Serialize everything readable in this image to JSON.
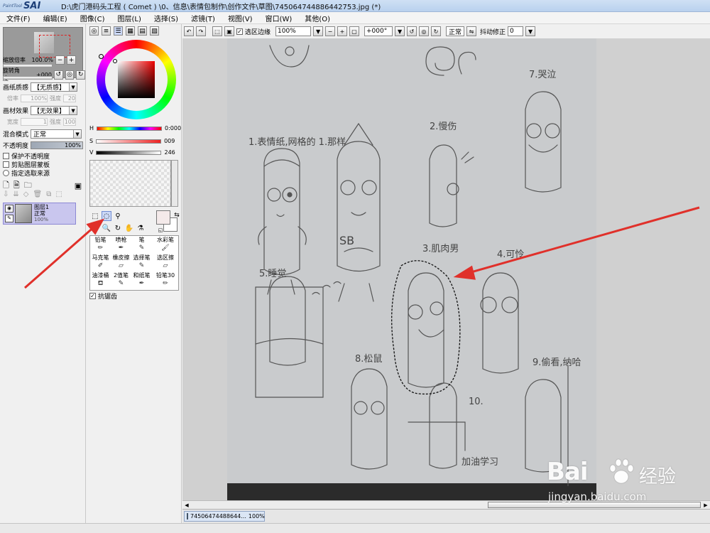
{
  "app": {
    "logo_small": "PaintTool",
    "logo_big": "SAI",
    "window_title": "D:\\虎门港码头工程 ( Comet ) \\0、信息\\表情包制作\\创作文件\\草图\\745064744886442753.jpg (*)"
  },
  "menu": [
    "文件(F)",
    "编辑(E)",
    "图像(C)",
    "图层(L)",
    "选择(S)",
    "滤镜(T)",
    "视图(V)",
    "窗口(W)",
    "其他(O)"
  ],
  "navigator": {
    "zoom_label": "缩放倍率",
    "zoom_value": "100.0%",
    "rotate_label": "旋转角度",
    "rotate_value": "+000"
  },
  "paper_texture": {
    "label": "画纸质感",
    "value": "【无质感】",
    "scale_label": "倍率",
    "scale_value": "100%",
    "strength_label": "强度",
    "strength_value": "20"
  },
  "paper_effect": {
    "label": "画材效果",
    "value": "【无效果】",
    "width_label": "宽度",
    "width_value": "1",
    "strength_label": "强度",
    "strength_value": "100"
  },
  "blend": {
    "label": "混合模式",
    "value": "正常"
  },
  "opacity": {
    "label": "不透明度",
    "value": "100%"
  },
  "options": {
    "protect_opacity": "保护不透明度",
    "clipping_group": "剪贴图层蒙板",
    "selection_source": "指定选取来源"
  },
  "layer": {
    "name": "图层1",
    "mode": "正常",
    "opacity": "100%"
  },
  "color": {
    "h_label": "H",
    "h_value": "0:000",
    "s_label": "S",
    "s_value": "009",
    "v_label": "V",
    "v_value": "246",
    "fg": "#f4eaea",
    "bg": "#ffffff"
  },
  "brushes": [
    {
      "label": "铅笔",
      "icon": "pencil-icon"
    },
    {
      "label": "喷枪",
      "icon": "airbrush-icon"
    },
    {
      "label": "笔",
      "icon": "pen-icon"
    },
    {
      "label": "水彩笔",
      "icon": "watercolor-icon"
    },
    {
      "label": "马克笔",
      "icon": "marker-icon"
    },
    {
      "label": "橡皮擦",
      "icon": "eraser-icon"
    },
    {
      "label": "选择笔",
      "icon": "select-pen-icon"
    },
    {
      "label": "选区擦",
      "icon": "select-eraser-icon"
    },
    {
      "label": "油漆桶",
      "icon": "bucket-icon"
    },
    {
      "label": "2值笔",
      "icon": "binary-pen-icon"
    },
    {
      "label": "和纸笔",
      "icon": "washi-pen-icon"
    },
    {
      "label": "铅笔30",
      "icon": "pencil30-icon"
    }
  ],
  "antialias": {
    "label": "抗锯齿"
  },
  "canvas_toolbar": {
    "selection_edge": "选区边缘",
    "zoom": "100%",
    "rotation": "+000°",
    "mode": "正常",
    "stabilizer_label": "抖动修正",
    "stabilizer_value": "0"
  },
  "sketch": {
    "labels": [
      {
        "text": "7.哭泣"
      },
      {
        "text": "1.表情纸,网格的 1.那样"
      },
      {
        "text": "2.慢伤"
      },
      {
        "text": "3.肌肉男"
      },
      {
        "text": "4.可怜"
      },
      {
        "text": "5.睡觉"
      },
      {
        "text": "8.松鼠"
      },
      {
        "text": "9.偷看,纳哈"
      },
      {
        "text": "10."
      },
      {
        "text": "加油学习"
      },
      {
        "text": "SB"
      }
    ]
  },
  "doc_tab": {
    "name": "74506474488644...",
    "zoom": "100%"
  },
  "watermark": {
    "logo": "Bai",
    "text": "经验",
    "url": "jingyan.baidu.com"
  },
  "accent": {
    "selection_highlight": "#c9c6ee",
    "arrow": "#e0302a"
  }
}
